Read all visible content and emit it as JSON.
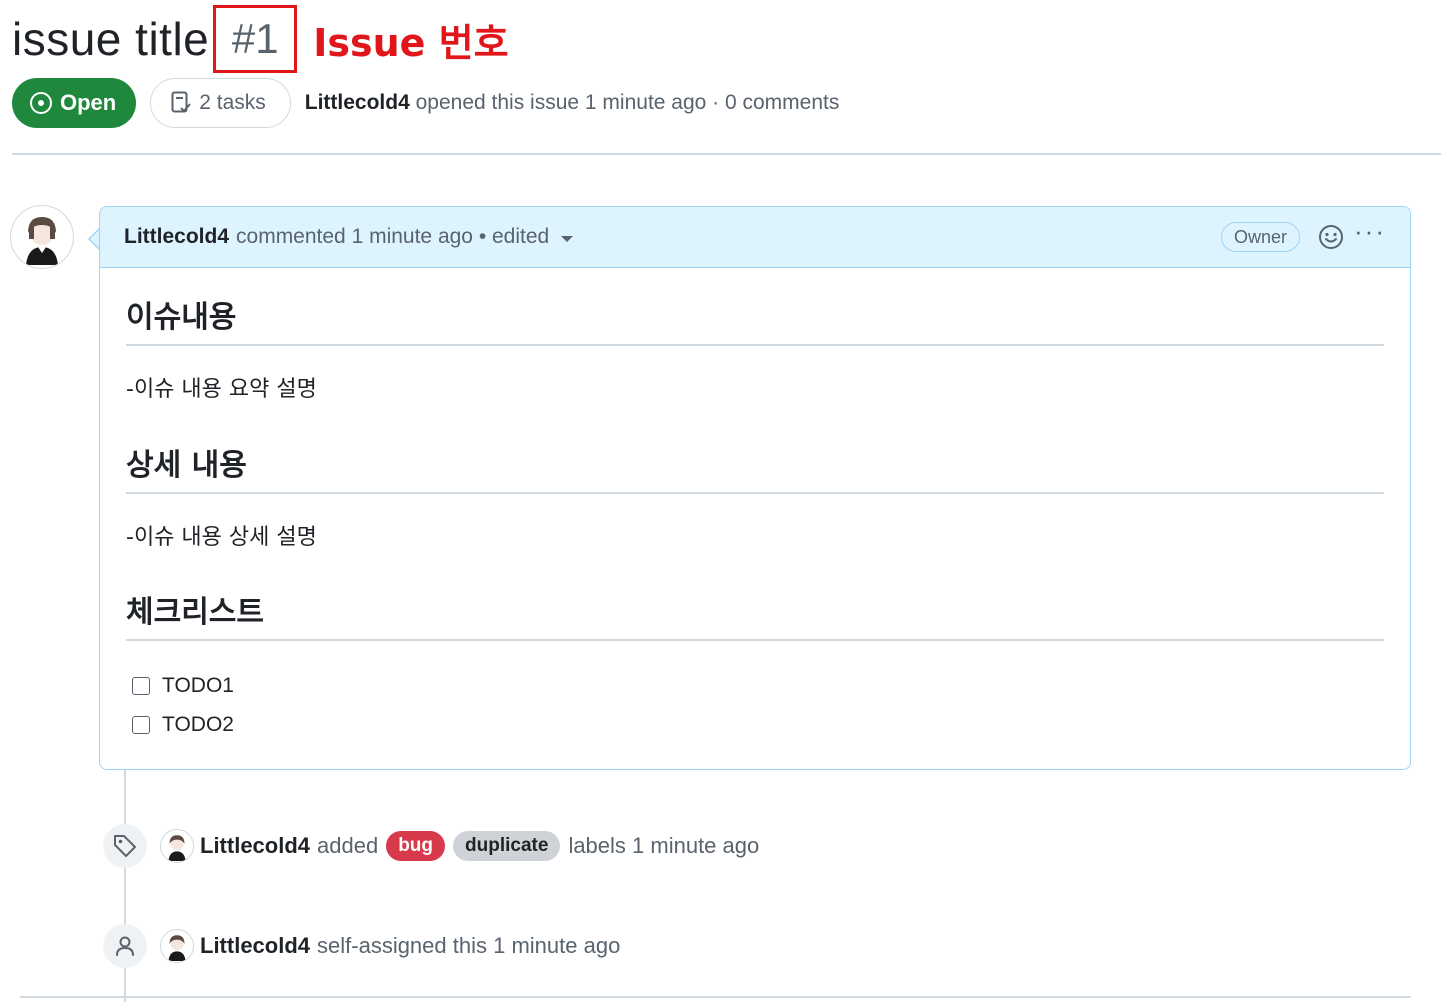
{
  "issue": {
    "title": "issue title",
    "number": "#1",
    "annotation": "Issue 번호",
    "state": "Open",
    "tasks": "2 tasks",
    "author": "Littlecold4",
    "opened_text": "opened this issue 1 minute ago · 0 comments"
  },
  "comment": {
    "author": "Littlecold4",
    "meta": "commented 1 minute ago • edited",
    "owner_badge": "Owner",
    "more": "···",
    "sections": [
      {
        "heading": "이슈내용",
        "text": "-이슈 내용 요약 설명"
      },
      {
        "heading": "상세 내용",
        "text": "-이슈 내용 상세 설명"
      },
      {
        "heading": "체크리스트"
      }
    ],
    "tasks": [
      {
        "label": "TODO1",
        "checked": false
      },
      {
        "label": "TODO2",
        "checked": false
      }
    ]
  },
  "timeline": {
    "labels_event": {
      "author": "Littlecold4",
      "verb": "added",
      "labels": [
        {
          "name": "bug",
          "color": "#d73a4a"
        },
        {
          "name": "duplicate",
          "color": "#cfd3d7"
        }
      ],
      "suffix": "labels 1 minute ago"
    },
    "assign_event": {
      "author": "Littlecold4",
      "text": "self-assigned this 1 minute ago"
    }
  },
  "icons": [
    "issue-opened-icon",
    "tasklist-icon",
    "smiley-icon",
    "kebab-horizontal-icon",
    "tag-icon",
    "person-icon"
  ],
  "colors": {
    "open": "#1f883d",
    "annotation": "#e0161b",
    "comment_header": "#ddf4ff",
    "comment_border": "#9fd3f5"
  }
}
